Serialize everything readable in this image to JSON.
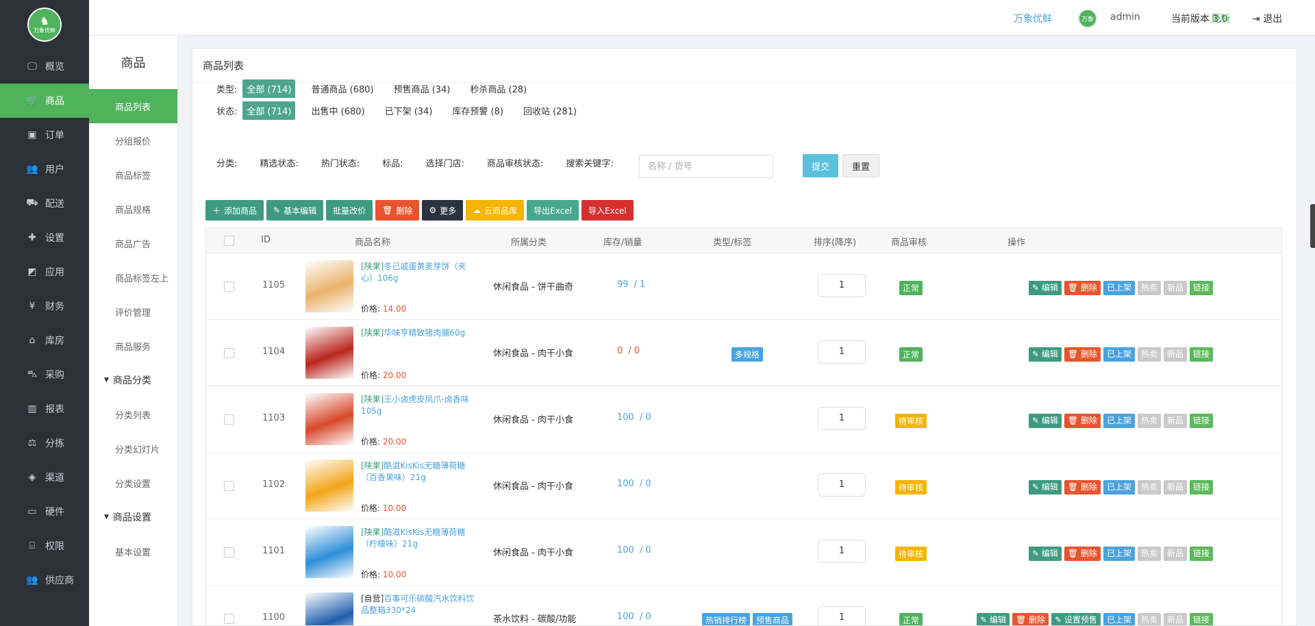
{
  "brand": {
    "logo_text": "万象优鲜",
    "logo_glyph": "elephant-icon"
  },
  "nav": [
    {
      "label": "概览",
      "icon": "monitor-icon",
      "glyph": "🖵"
    },
    {
      "label": "商品",
      "icon": "cart-icon",
      "glyph": "🛒",
      "active": true
    },
    {
      "label": "订单",
      "icon": "money-icon",
      "glyph": "▣"
    },
    {
      "label": "用户",
      "icon": "users-icon",
      "glyph": "👥"
    },
    {
      "label": "配送",
      "icon": "truck-icon",
      "glyph": "⛟"
    },
    {
      "label": "设置",
      "icon": "puzzle-icon",
      "glyph": "✚"
    },
    {
      "label": "应用",
      "icon": "apps-icon",
      "glyph": "◩"
    },
    {
      "label": "财务",
      "icon": "yen-icon",
      "glyph": "¥"
    },
    {
      "label": "库房",
      "icon": "home-icon",
      "glyph": "⌂"
    },
    {
      "label": "采购",
      "icon": "bus-icon",
      "glyph": "⛍"
    },
    {
      "label": "报表",
      "icon": "bar-chart-icon",
      "glyph": "▥"
    },
    {
      "label": "分拣",
      "icon": "balance-icon",
      "glyph": "⚖"
    },
    {
      "label": "渠道",
      "icon": "cube-icon",
      "glyph": "◈"
    },
    {
      "label": "硬件",
      "icon": "desktop-icon",
      "glyph": "▭"
    },
    {
      "label": "权限",
      "icon": "bank-icon",
      "glyph": "⌸"
    },
    {
      "label": "供应商",
      "icon": "group-icon",
      "glyph": "👥"
    }
  ],
  "subnav": {
    "title": "商品",
    "items": [
      {
        "type": "item",
        "label": "商品列表",
        "active": true
      },
      {
        "type": "item",
        "label": "分组报价"
      },
      {
        "type": "item",
        "label": "商品标签"
      },
      {
        "type": "item",
        "label": "商品规格"
      },
      {
        "type": "item",
        "label": "商品广告"
      },
      {
        "type": "item",
        "label": "商品标签左上"
      },
      {
        "type": "item",
        "label": "评价管理"
      },
      {
        "type": "item",
        "label": "商品服务"
      },
      {
        "type": "group",
        "label": "商品分类"
      },
      {
        "type": "item",
        "label": "分类列表"
      },
      {
        "type": "item",
        "label": "分类幻灯片"
      },
      {
        "type": "item",
        "label": "分类设置"
      },
      {
        "type": "group",
        "label": "商品设置"
      },
      {
        "type": "item",
        "label": "基本设置"
      }
    ]
  },
  "header": {
    "brand_link": "万象优鲜",
    "avatar_text": "万象",
    "user": "admin",
    "version_label": "当前版本  3.0",
    "update": "更新",
    "logout": "退出"
  },
  "panel": {
    "title": "商品列表"
  },
  "filters": {
    "type_label": "类型:",
    "type_options": [
      "全部 (714)",
      "普通商品 (680)",
      "预售商品 (34)",
      "秒杀商品 (28)"
    ],
    "status_label": "状态:",
    "status_options": [
      "全部 (714)",
      "出售中 (680)",
      "已下架 (34)",
      "库存预警 (8)",
      "回收站 (281)"
    ],
    "fields": [
      "分类:",
      "精选状态:",
      "热门状态:",
      "标品:",
      "选择门店:",
      "商品审核状态:",
      "搜索关键字:"
    ],
    "search_placeholder": "名称 / 货号",
    "submit": "提交",
    "reset": "重置"
  },
  "toolbar": [
    {
      "label": "添加商品",
      "icon": "plus-icon",
      "glyph": "＋",
      "style": "green"
    },
    {
      "label": "基本编辑",
      "icon": "pencil-icon",
      "glyph": "✎",
      "style": "green"
    },
    {
      "label": "批量改价",
      "icon": "",
      "glyph": "",
      "style": "green"
    },
    {
      "label": "删除",
      "icon": "trash-icon",
      "glyph": "🗑",
      "style": "red"
    },
    {
      "label": "更多",
      "icon": "gear-icon",
      "glyph": "⚙",
      "style": "dark"
    },
    {
      "label": "云商品库",
      "icon": "cloud-icon",
      "glyph": "☁",
      "style": "yellow"
    },
    {
      "label": "导出Excel",
      "icon": "",
      "glyph": "",
      "style": "teal"
    },
    {
      "label": "导入Excel",
      "icon": "",
      "glyph": "",
      "style": "crimson"
    }
  ],
  "table": {
    "columns": [
      "ID",
      "商品名称",
      "所属分类",
      "库存/销量",
      "类型/标签",
      "排序(降序)",
      "商品审核",
      "操作"
    ],
    "price_label": "价格: ",
    "rows": [
      {
        "id": "1105",
        "source": "[陕果]",
        "name": "冬己戚蛋黄麦芽饼（夹心）106g",
        "price": "14.00",
        "category": "休闲食品 - 饼干曲奇",
        "stock": "99",
        "sales": "/ 1",
        "tags": [],
        "sort": "1",
        "audit": "正常",
        "audit_ok": true,
        "thumb": "#e9b36a",
        "ops": [
          "✎ 编辑",
          "🗑 删除",
          "已上架",
          "热卖",
          "新品",
          "链接"
        ]
      },
      {
        "id": "1104",
        "source": "[陕果]",
        "name": "华味亨精致猪肉脯60g",
        "price": "20.00",
        "category": "休闲食品 - 肉干小食",
        "stock": "0",
        "sales": "/ 0",
        "tags": [
          "多规格"
        ],
        "sort": "1",
        "audit": "正常",
        "audit_ok": true,
        "thumb": "#b8261c",
        "ops": [
          "✎ 编辑",
          "🗑 删除",
          "已上架",
          "热卖",
          "新品",
          "链接"
        ]
      },
      {
        "id": "1103",
        "source": "[陕果]",
        "name": "王小卤虎皮凤爪-卤香味105g",
        "price": "20.00",
        "category": "休闲食品 - 肉干小食",
        "stock": "100",
        "sales": "/ 0",
        "tags": [],
        "sort": "1",
        "audit": "待审核",
        "audit_ok": false,
        "thumb": "#d8482a",
        "ops": [
          "✎ 编辑",
          "🗑 删除",
          "已上架",
          "热卖",
          "新品",
          "链接"
        ]
      },
      {
        "id": "1102",
        "source": "[陕果]",
        "name": "酷滋KisKis无糖薄荷糖（百香果味）21g",
        "price": "10.00",
        "category": "休闲食品 - 肉干小食",
        "stock": "100",
        "sales": "/ 0",
        "tags": [],
        "sort": "1",
        "audit": "待审核",
        "audit_ok": false,
        "thumb": "#f2a417",
        "ops": [
          "✎ 编辑",
          "🗑 删除",
          "已上架",
          "热卖",
          "新品",
          "链接"
        ]
      },
      {
        "id": "1101",
        "source": "[陕果]",
        "name": "酷滋KisKis无糖薄荷糖（柠檬味）21g",
        "price": "10.00",
        "category": "休闲食品 - 肉干小食",
        "stock": "100",
        "sales": "/ 0",
        "tags": [],
        "sort": "1",
        "audit": "待审核",
        "audit_ok": false,
        "thumb": "#2d8ed8",
        "ops": [
          "✎ 编辑",
          "🗑 删除",
          "已上架",
          "热卖",
          "新品",
          "链接"
        ]
      },
      {
        "id": "1100",
        "source": "[自营]",
        "name": "百事可乐碳酸汽水饮料饮品整箱330*24",
        "price": "",
        "category": "茶水饮料 - 碳酸/功能",
        "stock": "100",
        "sales": "/ 0",
        "tags": [
          "热销排行榜",
          "预售商品"
        ],
        "sort": "1",
        "audit": "正常",
        "audit_ok": true,
        "thumb": "#1e5fae",
        "ops": [
          "✎ 编辑",
          "🗑 删除",
          "✎ 设置预售",
          "已上架",
          "热卖",
          "新品",
          "链接"
        ]
      }
    ]
  }
}
